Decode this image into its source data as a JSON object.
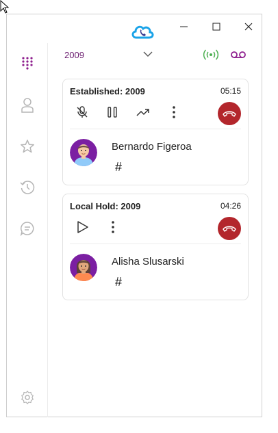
{
  "app": {
    "logo": "cloud-phone-logo"
  },
  "window_controls": {
    "minimize": "minimize-icon",
    "maximize": "maximize-icon",
    "close": "close-icon"
  },
  "sidebar": {
    "items": [
      {
        "name": "dialpad-icon",
        "active": true
      },
      {
        "name": "contacts-icon",
        "active": false
      },
      {
        "name": "favorites-icon",
        "active": false
      },
      {
        "name": "history-icon",
        "active": false
      },
      {
        "name": "chat-icon",
        "active": false
      }
    ],
    "settings": "settings-icon"
  },
  "header": {
    "line": "2009",
    "signal_color": "#4caf50",
    "voicemail_color": "#8e1e8e"
  },
  "calls": [
    {
      "title": "Established: 2009",
      "duration": "05:15",
      "caller": "Bernardo Figeroa",
      "dtmf": "#",
      "controls": [
        "mute-icon",
        "hold-icon",
        "transfer-icon",
        "more-icon"
      ]
    },
    {
      "title": "Local Hold: 2009",
      "duration": "04:26",
      "caller": "Alisha Slusarski",
      "dtmf": "#",
      "controls": [
        "resume-icon",
        "more-icon"
      ]
    }
  ],
  "colors": {
    "accent": "#8e1e8e",
    "hangup": "#b3262c"
  }
}
